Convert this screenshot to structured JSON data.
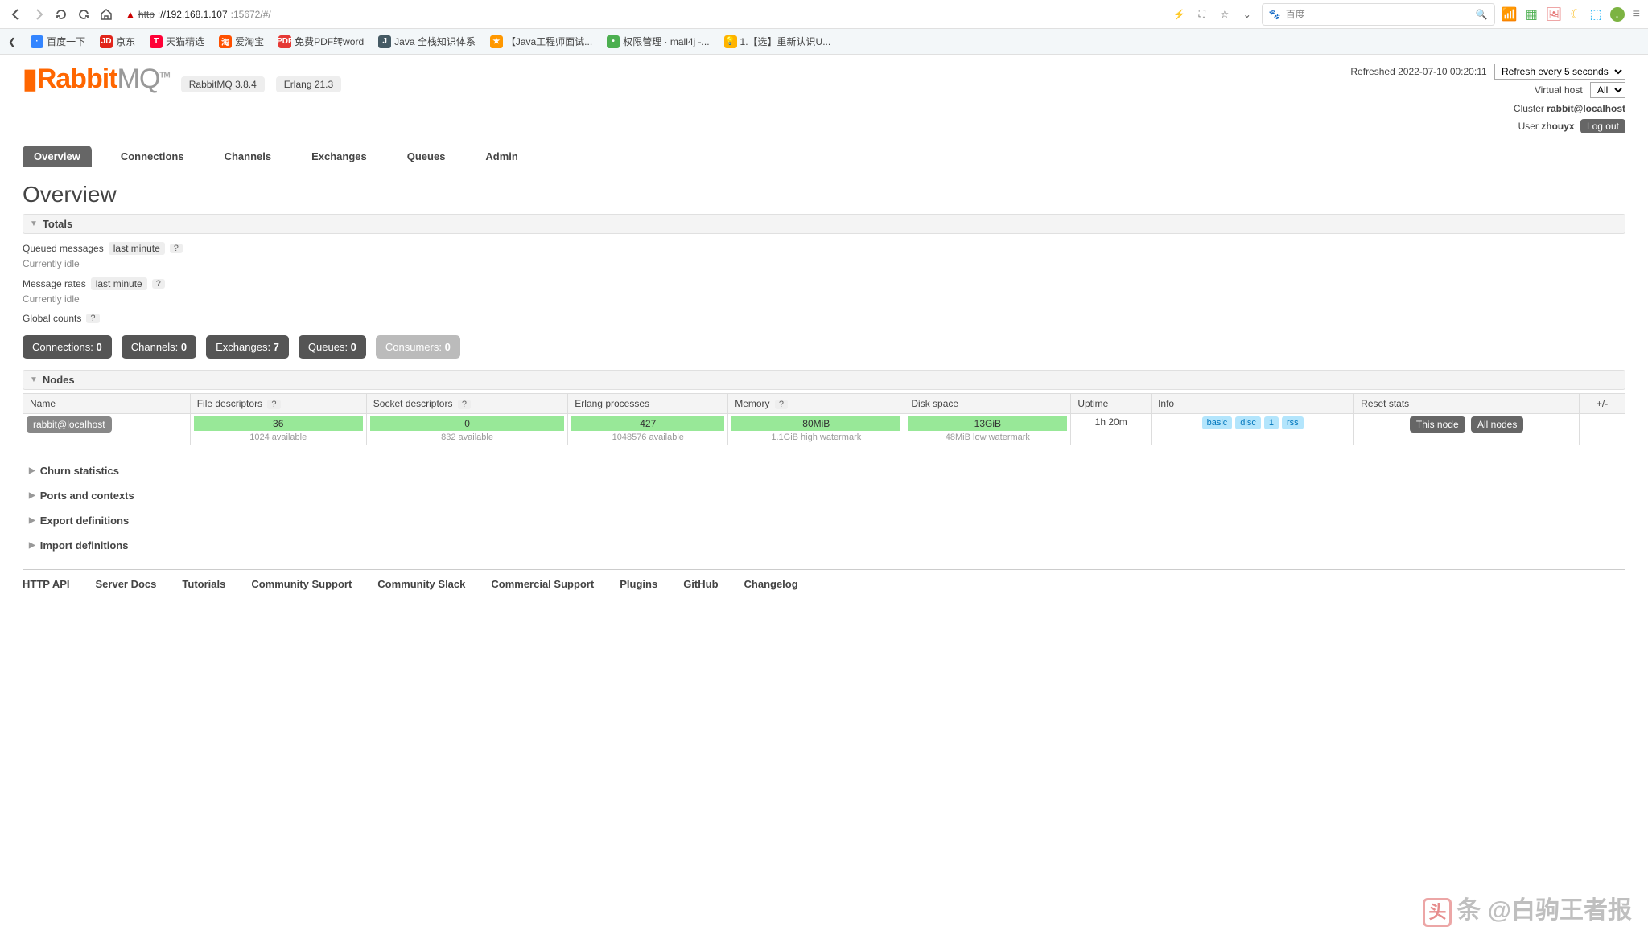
{
  "browser": {
    "url_proto": "http",
    "url_host": "://192.168.1.107",
    "url_port": ":15672/#/",
    "search_placeholder": "百度",
    "bookmarks": [
      {
        "label": "百度一下",
        "color": "#3385ff"
      },
      {
        "label": "京东",
        "color": "#e1251b",
        "badge": "JD"
      },
      {
        "label": "天猫精选",
        "color": "#ff0036",
        "badge": "T"
      },
      {
        "label": "爱淘宝",
        "color": "#ff5000",
        "badge": "淘"
      },
      {
        "label": "免费PDF转word",
        "color": "#e53935",
        "badge": "PDF"
      },
      {
        "label": "Java 全栈知识体系",
        "color": "#455a64",
        "badge": "J"
      },
      {
        "label": "【Java工程师面试...",
        "color": "#ff9800",
        "badge": "★"
      },
      {
        "label": "权限管理 · mall4j -...",
        "color": "#4caf50",
        "badge": "•"
      },
      {
        "label": "1.【选】重新认识U...",
        "color": "#ffb300",
        "badge": "💡"
      }
    ]
  },
  "header": {
    "logo_rabbit": "Rabbit",
    "logo_mq": "MQ",
    "logo_tm": "TM",
    "version": "RabbitMQ 3.8.4",
    "erlang": "Erlang 21.3",
    "refreshed_label": "Refreshed",
    "refreshed_ts": "2022-07-10 00:20:11",
    "refresh_select": "Refresh every 5 seconds",
    "vhost_label": "Virtual host",
    "vhost_value": "All",
    "cluster_label": "Cluster",
    "cluster_value": "rabbit@localhost",
    "user_label": "User",
    "user_value": "zhouyx",
    "logout": "Log out"
  },
  "tabs": [
    "Overview",
    "Connections",
    "Channels",
    "Exchanges",
    "Queues",
    "Admin"
  ],
  "page_title": "Overview",
  "sections": {
    "totals": "Totals",
    "queued_msgs": "Queued messages",
    "last_minute": "last minute",
    "idle": "Currently idle",
    "msg_rates": "Message rates",
    "global_counts": "Global counts",
    "nodes": "Nodes",
    "churn": "Churn statistics",
    "ports": "Ports and contexts",
    "export": "Export definitions",
    "import": "Import definitions"
  },
  "counts": [
    {
      "label": "Connections:",
      "value": "0",
      "muted": false
    },
    {
      "label": "Channels:",
      "value": "0",
      "muted": false
    },
    {
      "label": "Exchanges:",
      "value": "7",
      "muted": false
    },
    {
      "label": "Queues:",
      "value": "0",
      "muted": false
    },
    {
      "label": "Consumers:",
      "value": "0",
      "muted": true
    }
  ],
  "nodes_table": {
    "headers": [
      "Name",
      "File descriptors",
      "Socket descriptors",
      "Erlang processes",
      "Memory",
      "Disk space",
      "Uptime",
      "Info",
      "Reset stats",
      "+/-"
    ],
    "help_cols": [
      1,
      2,
      4
    ],
    "row": {
      "name": "rabbit@localhost",
      "fd_val": "36",
      "fd_sub": "1024 available",
      "sd_val": "0",
      "sd_sub": "832 available",
      "ep_val": "427",
      "ep_sub": "1048576 available",
      "mem_val": "80MiB",
      "mem_sub": "1.1GiB high watermark",
      "disk_val": "13GiB",
      "disk_sub": "48MiB low watermark",
      "uptime": "1h 20m",
      "info": [
        "basic",
        "disc",
        "1",
        "rss"
      ],
      "reset_this": "This node",
      "reset_all": "All nodes"
    }
  },
  "footer": [
    "HTTP API",
    "Server Docs",
    "Tutorials",
    "Community Support",
    "Community Slack",
    "Commercial Support",
    "Plugins",
    "GitHub",
    "Changelog"
  ],
  "watermark": "@白驹王者报"
}
